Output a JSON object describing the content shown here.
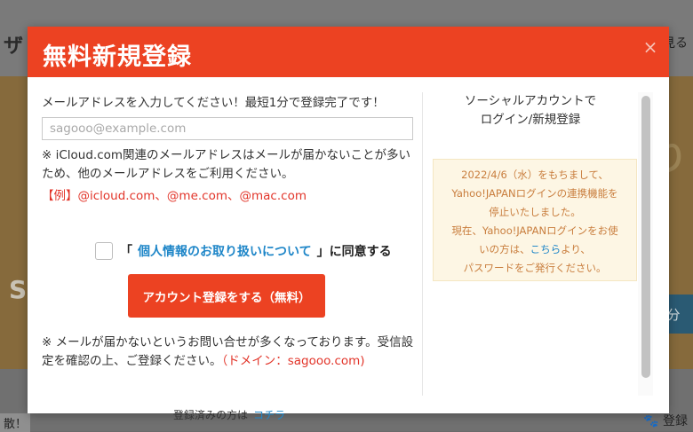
{
  "background": {
    "logo": "ザ",
    "top_right": "見る",
    "banner_right_letter": "り",
    "banner_left_letter": "S",
    "right_button": "分",
    "bottom_left": "散！",
    "bottom_right": "🐾 登録"
  },
  "modal": {
    "title": "無料新規登録",
    "close": "×",
    "instruction": "メールアドレスを入力してください！最短1分で登録完了です！",
    "email": {
      "value": "",
      "placeholder": "sagooo@example.com"
    },
    "note1": "※ iCloud.com関連のメールアドレスはメールが届かないことが多いため、他のメールアドレスをご利用ください。",
    "example": "【例】@icloud.com、@me.com、@mac.com",
    "agree": {
      "open": "「",
      "link": "個人情報のお取り扱いについて",
      "close": "」に同意する"
    },
    "submit_label": "アカウント登録をする（無料）",
    "note2_text": "※ メールが届かないというお問い合せが多くなっております。受信設定を確認の上、ご登録ください。",
    "note2_red": "（ドメイン：sagooo.com)",
    "registered_text": "登録済みの方は",
    "registered_link": "コチラ",
    "social": {
      "title_line1": "ソーシャルアカウントで",
      "title_line2": "ログイン/新規登録",
      "notice_1": "2022/4/6（水）をもちまして、",
      "notice_2": "Yahoo!JAPANログインの連携機能を",
      "notice_3": "停止いたしました。",
      "notice_4": "現在、Yahoo!JAPANログインをお使",
      "notice_5a": "いの方は、",
      "notice_5_link": "こちら",
      "notice_5b": "より、",
      "notice_6": "パスワードをご発行ください。"
    }
  },
  "colors": {
    "accent": "#ec4222",
    "link": "#1e86c8",
    "notice_bg": "#fdf6e4",
    "notice_text": "#c97e3e"
  }
}
